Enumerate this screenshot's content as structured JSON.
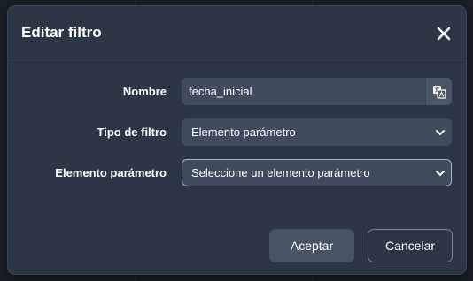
{
  "dialog": {
    "title": "Editar filtro",
    "close_icon": "close-icon"
  },
  "form": {
    "name": {
      "label": "Nombre",
      "value": "fecha_inicial",
      "addon_icon": "translate-icon"
    },
    "filter_type": {
      "label": "Tipo de filtro",
      "selected": "Elemento parámetro"
    },
    "parameter_element": {
      "label": "Elemento parámetro",
      "selected": "Seleccione un elemento parámetro"
    }
  },
  "footer": {
    "accept_label": "Aceptar",
    "cancel_label": "Cancelar"
  },
  "colors": {
    "dialog_background": "#2c3644",
    "control_background": "#404c5d",
    "text": "#ffffff"
  }
}
